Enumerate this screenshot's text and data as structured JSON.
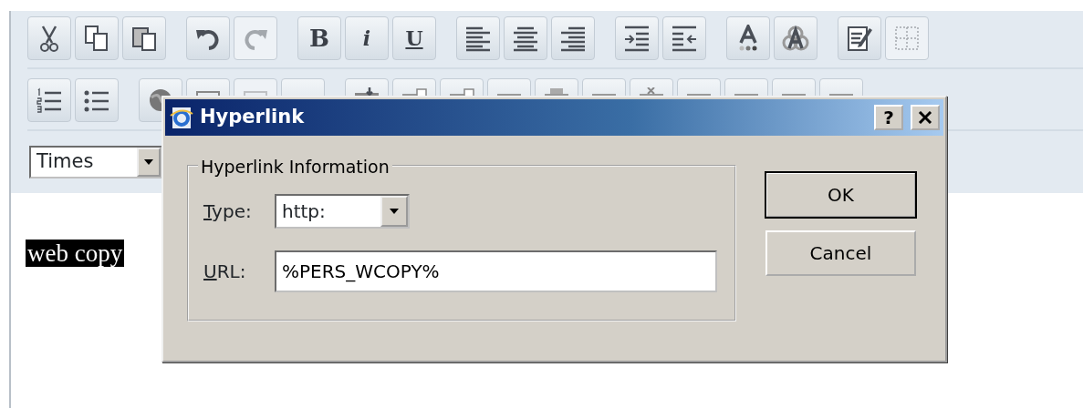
{
  "toolbar_rows": [
    [
      [
        {
          "kind": "cut",
          "disabled": false
        },
        {
          "kind": "copy",
          "disabled": false
        },
        {
          "kind": "paste",
          "disabled": false
        }
      ],
      [
        {
          "kind": "undo",
          "disabled": false
        },
        {
          "kind": "redo",
          "disabled": true
        }
      ],
      [
        {
          "kind": "text",
          "label": "B",
          "disabled": false
        },
        {
          "kind": "text",
          "label": "i",
          "disabled": false
        },
        {
          "kind": "text",
          "label": "U",
          "disabled": false
        }
      ],
      [
        {
          "kind": "align-left",
          "disabled": false
        },
        {
          "kind": "align-center",
          "disabled": false
        },
        {
          "kind": "align-right",
          "disabled": false
        }
      ],
      [
        {
          "kind": "indent",
          "disabled": false
        },
        {
          "kind": "outdent",
          "disabled": false
        }
      ],
      [
        {
          "kind": "font-color",
          "disabled": false
        },
        {
          "kind": "highlight",
          "disabled": false
        }
      ],
      [
        {
          "kind": "edit-source",
          "disabled": false
        },
        {
          "kind": "grid",
          "disabled": true
        }
      ]
    ],
    [
      [
        {
          "kind": "numbered-list",
          "disabled": false
        },
        {
          "kind": "bullet-list",
          "disabled": false
        }
      ],
      [
        {
          "kind": "globe",
          "disabled": false
        },
        {
          "kind": "image",
          "disabled": false
        },
        {
          "kind": "image",
          "disabled": true
        },
        {
          "kind": "blank"
        }
      ],
      [
        {
          "kind": "table-insert"
        },
        {
          "kind": "table-row"
        },
        {
          "kind": "table-row"
        },
        {
          "kind": "table-line"
        },
        {
          "kind": "table-merge"
        },
        {
          "kind": "table-line"
        },
        {
          "kind": "table-delete"
        },
        {
          "kind": "table-line"
        },
        {
          "kind": "table-line"
        },
        {
          "kind": "table-line"
        },
        {
          "kind": "table-line"
        }
      ]
    ]
  ],
  "font_select": {
    "value": "Times"
  },
  "editor": {
    "selected_text": "web copy"
  },
  "dialog": {
    "title": "Hyperlink",
    "help": "?",
    "group": {
      "legend": "Hyperlink Information",
      "fields": [
        {
          "kind": "select",
          "label_key": "T",
          "label_rest": "ype:",
          "value": "http:"
        },
        {
          "kind": "text",
          "label_key": "U",
          "label_rest": "RL:",
          "value": "%PERS_WCOPY%"
        }
      ]
    },
    "buttons": [
      {
        "label": "OK",
        "default": true
      },
      {
        "label": "Cancel",
        "default": false
      }
    ]
  }
}
